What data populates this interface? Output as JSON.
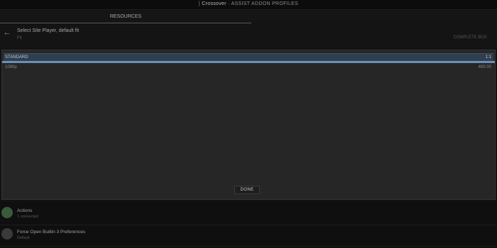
{
  "topbar": {
    "prefix": "|",
    "title": "Crossover",
    "suffix": "· ASSIST ADDON PROFILES"
  },
  "tabs": [
    {
      "label": "RESOURCES"
    },
    {
      "label": ""
    }
  ],
  "dialog": {
    "title": "Select Site Player, default fit",
    "subtitle": "Fit",
    "action": "COMPLETE BOX"
  },
  "list": {
    "rows": [
      {
        "label": "STANDARD",
        "value": "1:1"
      },
      {
        "label": "1080p",
        "value": "400.00"
      }
    ]
  },
  "done_label": "DONE",
  "bottom": {
    "items": [
      {
        "title": "Actions",
        "subtitle": "1 connected",
        "action": ""
      },
      {
        "title": "Force Open Builtin 3 Preferences",
        "subtitle": "Default",
        "action": ""
      }
    ]
  },
  "colors": {
    "selection": "#2f3f50",
    "divider": "#6a8fb8",
    "panel": "#262626"
  }
}
